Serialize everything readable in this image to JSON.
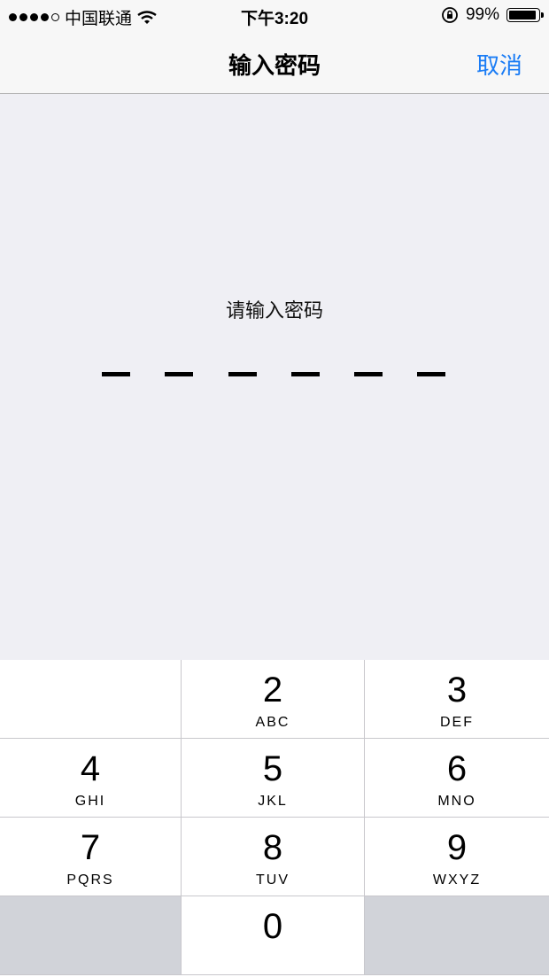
{
  "status": {
    "carrier": "中国联通",
    "time": "下午3:20",
    "battery_pct": "99%",
    "battery_level": 0.99,
    "signal_bars": 4
  },
  "nav": {
    "title": "输入密码",
    "cancel_label": "取消",
    "accent_color": "#1a7cf5"
  },
  "passcode": {
    "prompt": "请输入密码",
    "length": 6,
    "entered": 0
  },
  "keypad": {
    "keys": [
      {
        "digit": "",
        "letters": ""
      },
      {
        "digit": "2",
        "letters": "ABC"
      },
      {
        "digit": "3",
        "letters": "DEF"
      },
      {
        "digit": "4",
        "letters": "GHI"
      },
      {
        "digit": "5",
        "letters": "JKL"
      },
      {
        "digit": "6",
        "letters": "MNO"
      },
      {
        "digit": "7",
        "letters": "PQRS"
      },
      {
        "digit": "8",
        "letters": "TUV"
      },
      {
        "digit": "9",
        "letters": "WXYZ"
      },
      {
        "digit": "",
        "letters": ""
      },
      {
        "digit": "0",
        "letters": ""
      },
      {
        "digit": "",
        "letters": ""
      }
    ]
  }
}
